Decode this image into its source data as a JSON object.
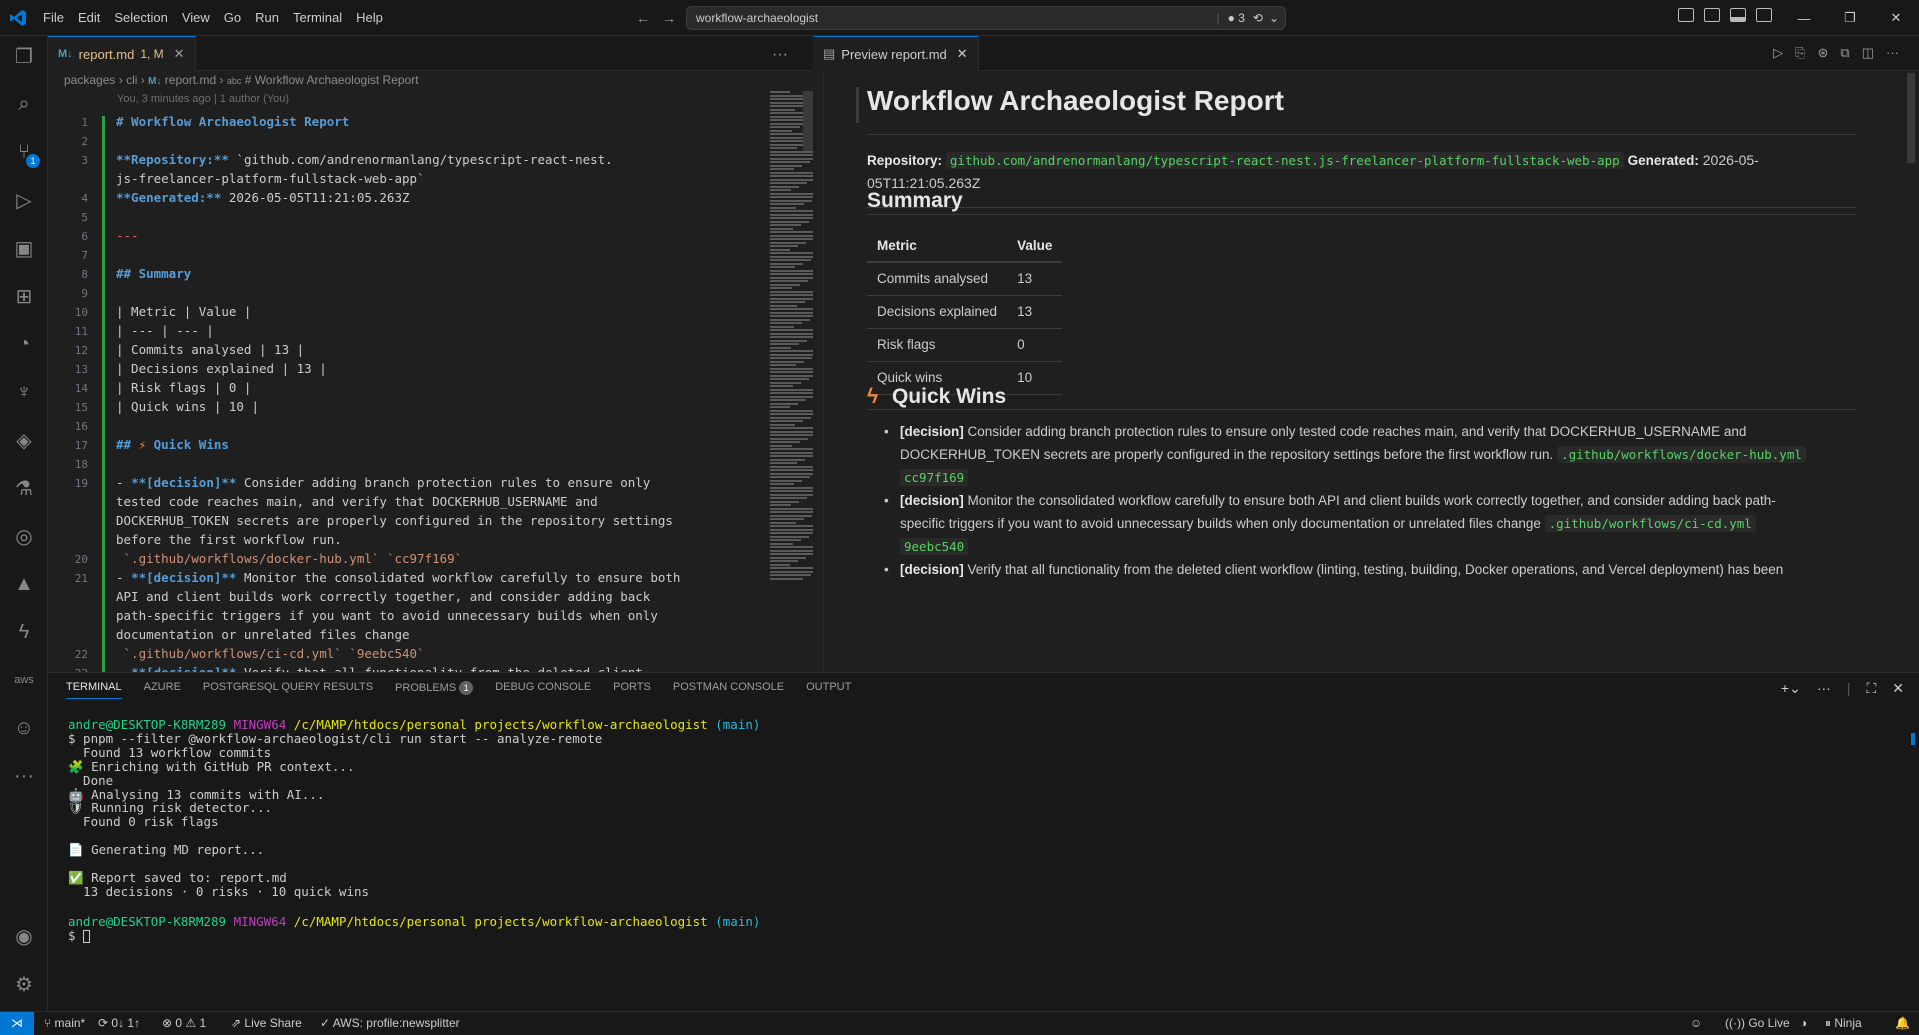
{
  "menu": [
    "File",
    "Edit",
    "Selection",
    "View",
    "Go",
    "Run",
    "Terminal",
    "Help"
  ],
  "search": {
    "value": "workflow-archaeologist",
    "indicator": "3"
  },
  "tabs": {
    "editor_tab": {
      "label": "report.md",
      "status": "1, M"
    },
    "preview_tab": {
      "label": "Preview report.md"
    }
  },
  "breadcrumb": {
    "parts": [
      "packages",
      "cli",
      "report.md",
      "# Workflow Archaeologist Report"
    ]
  },
  "codelens": "You, 3 minutes ago | 1 author (You)",
  "editor_lines": [
    {
      "n": "1",
      "text": "# Workflow Archaeologist Report"
    },
    {
      "n": "2",
      "text": ""
    },
    {
      "n": "3",
      "text": "**Repository:** `github.com/andrenormanlang/typescript-react-nest."
    },
    {
      "n": "",
      "text": "js-freelancer-platform-fullstack-web-app`"
    },
    {
      "n": "4",
      "text": "**Generated:** 2026-05-05T11:21:05.263Z"
    },
    {
      "n": "5",
      "text": ""
    },
    {
      "n": "6",
      "text": "---"
    },
    {
      "n": "7",
      "text": ""
    },
    {
      "n": "8",
      "text": "## Summary"
    },
    {
      "n": "9",
      "text": ""
    },
    {
      "n": "10",
      "text": "| Metric | Value |"
    },
    {
      "n": "11",
      "text": "| --- | --- |"
    },
    {
      "n": "12",
      "text": "| Commits analysed | 13 |"
    },
    {
      "n": "13",
      "text": "| Decisions explained | 13 |"
    },
    {
      "n": "14",
      "text": "| Risk flags | 0 |"
    },
    {
      "n": "15",
      "text": "| Quick wins | 10 |"
    },
    {
      "n": "16",
      "text": ""
    },
    {
      "n": "17",
      "text": "## ⚡ Quick Wins"
    },
    {
      "n": "18",
      "text": ""
    },
    {
      "n": "19",
      "text": "- **[decision]** Consider adding branch protection rules to ensure only"
    },
    {
      "n": "",
      "text": "tested code reaches main, and verify that DOCKERHUB_USERNAME and"
    },
    {
      "n": "",
      "text": "DOCKERHUB_TOKEN secrets are properly configured in the repository settings"
    },
    {
      "n": "",
      "text": "before the first workflow run."
    },
    {
      "n": "20",
      "text": " `.github/workflows/docker-hub.yml` `cc97f169`"
    },
    {
      "n": "21",
      "text": "- **[decision]** Monitor the consolidated workflow carefully to ensure both"
    },
    {
      "n": "",
      "text": "API and client builds work correctly together, and consider adding back"
    },
    {
      "n": "",
      "text": "path-specific triggers if you want to avoid unnecessary builds when only"
    },
    {
      "n": "",
      "text": "documentation or unrelated files change"
    },
    {
      "n": "22",
      "text": " `.github/workflows/ci-cd.yml` `9eebc540`"
    },
    {
      "n": "23",
      "text": "- **[decision]** Verify that all functionality from the deleted client"
    }
  ],
  "preview": {
    "title": "Workflow Archaeologist Report",
    "repo_label": "Repository:",
    "repo_value": "github.com/andrenormanlang/typescript-react-nest.js-freelancer-platform-fullstack-web-app",
    "generated_label": "Generated:",
    "generated_value_a": "2026-05-",
    "generated_value_b": "05T11:21:05.263Z",
    "summary_heading": "Summary",
    "table_headers": [
      "Metric",
      "Value"
    ],
    "table_rows": [
      [
        "Commits analysed",
        "13"
      ],
      [
        "Decisions explained",
        "13"
      ],
      [
        "Risk flags",
        "0"
      ],
      [
        "Quick wins",
        "10"
      ]
    ],
    "quickwins_heading": "Quick Wins",
    "bullets": [
      {
        "tag": "[decision]",
        "text_a": "Consider adding branch protection rules to ensure only tested code reaches main, and verify that DOCKERHUB_USERNAME and",
        "text_b": "DOCKERHUB_TOKEN secrets are properly configured in the repository settings before the first workflow run.",
        "code1": ".github/workflows/docker-hub.yml",
        "code2": "cc97f169"
      },
      {
        "tag": "[decision]",
        "text_a": "Monitor the consolidated workflow carefully to ensure both API and client builds work correctly together, and consider adding back path-",
        "text_b": "specific triggers if you want to avoid unnecessary builds when only documentation or unrelated files change",
        "code1": ".github/workflows/ci-cd.yml",
        "code2": "9eebc540"
      },
      {
        "tag": "[decision]",
        "text_a": "Verify that all functionality from the deleted client workflow (linting, testing, building, Docker operations, and Vercel deployment) has been"
      }
    ]
  },
  "panel": {
    "tabs": [
      "TERMINAL",
      "AZURE",
      "POSTGRESQL QUERY RESULTS",
      "PROBLEMS",
      "DEBUG CONSOLE",
      "PORTS",
      "POSTMAN CONSOLE",
      "OUTPUT"
    ],
    "problems_count": "1"
  },
  "terminal": {
    "user": "andre@DESKTOP-K8RM289",
    "shell": "MINGW64",
    "path": "/c/MAMP/htdocs/personal projects/workflow-archaeologist",
    "branch": "(main)",
    "command": "$ pnpm --filter @workflow-archaeologist/cli run start -- analyze-remote",
    "output": [
      "  Found 13 workflow commits",
      "🧩 Enriching with GitHub PR context...",
      "  Done",
      "🤖 Analysing 13 commits with AI...",
      "🛡 Running risk detector...",
      "  Found 0 risk flags",
      "",
      "📄 Generating MD report...",
      "",
      "✅ Report saved to: report.md",
      "  13 decisions · 0 risks · 10 quick wins"
    ],
    "prompt": "$ "
  },
  "statusbar": {
    "branch": "main*",
    "sync": "0↓ 1↑",
    "problems": "⊗ 0 ⚠ 1",
    "liveshare": "Live Share",
    "aws": "AWS: profile:newsplitter",
    "golive": "Go Live",
    "ninja": "Ninja"
  },
  "colors": {
    "accent": "#0078d4",
    "background": "#1f1f1f",
    "sidebar": "#181818"
  }
}
